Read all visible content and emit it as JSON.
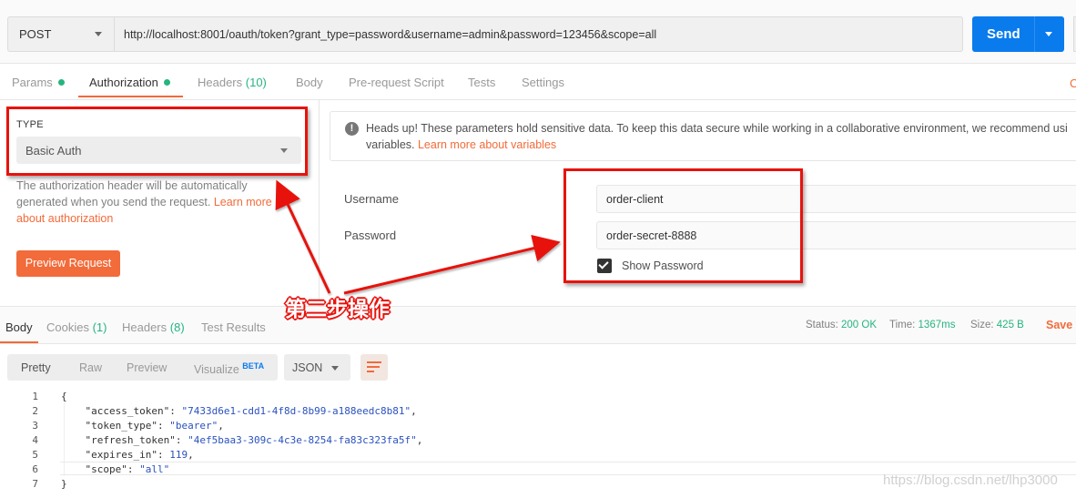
{
  "request": {
    "method": "POST",
    "url": "http://localhost:8001/oauth/token?grant_type=password&username=admin&password=123456&scope=all",
    "send_label": "Send"
  },
  "tabs": [
    {
      "label": "Params"
    },
    {
      "label": "Authorization"
    },
    {
      "label": "Headers",
      "count": "(10)"
    },
    {
      "label": "Body"
    },
    {
      "label": "Pre-request Script"
    },
    {
      "label": "Tests"
    },
    {
      "label": "Settings"
    }
  ],
  "cookies_link": "C",
  "auth": {
    "type_label": "TYPE",
    "type_value": "Basic Auth",
    "desc_text": "The authorization header will be automatically generated when you send the request. ",
    "desc_link": "Learn more about authorization",
    "preview_button": "Preview Request"
  },
  "notice": {
    "text": "Heads up! These parameters hold sensitive data. To keep this data secure while working in a collaborative environment, we recommend usi",
    "text2": "variables. ",
    "link": "Learn more about variables"
  },
  "fields": {
    "username_label": "Username",
    "username_value": "order-client",
    "password_label": "Password",
    "password_value": "order-secret-8888",
    "show_password_label": "Show Password"
  },
  "response": {
    "tabs": [
      {
        "label": "Body"
      },
      {
        "label": "Cookies",
        "count": "(1)"
      },
      {
        "label": "Headers",
        "count": "(8)"
      },
      {
        "label": "Test Results"
      }
    ],
    "status_label": "Status:",
    "status_value": "200 OK",
    "time_label": "Time:",
    "time_value": "1367ms",
    "size_label": "Size:",
    "size_value": "425 B",
    "save_label": "Save R",
    "view_options": [
      "Pretty",
      "Raw",
      "Preview",
      "Visualize"
    ],
    "beta": "BETA",
    "format": "JSON"
  },
  "code_lines": [
    {
      "n": "1",
      "t": "{"
    },
    {
      "n": "2",
      "k": "\"access_token\"",
      "v": "\"7433d6e1-cdd1-4f8d-8b99-a188eedc8b81\"",
      "e": ","
    },
    {
      "n": "3",
      "k": "\"token_type\"",
      "v": "\"bearer\"",
      "e": ","
    },
    {
      "n": "4",
      "k": "\"refresh_token\"",
      "v": "\"4ef5baa3-309c-4c3e-8254-fa83c323fa5f\"",
      "e": ","
    },
    {
      "n": "5",
      "k": "\"expires_in\"",
      "v": "119",
      "e": ","
    },
    {
      "n": "6",
      "k": "\"scope\"",
      "v": "\"all\"",
      "e": ""
    },
    {
      "n": "7",
      "t": "}"
    }
  ],
  "annotation": "第二步操作",
  "watermark": "https://blog.csdn.net/lhp3000",
  "colors": {
    "accent": "#f26b3a",
    "send": "#097bed",
    "ok": "#26b47f",
    "annotation": "#e8120c"
  }
}
